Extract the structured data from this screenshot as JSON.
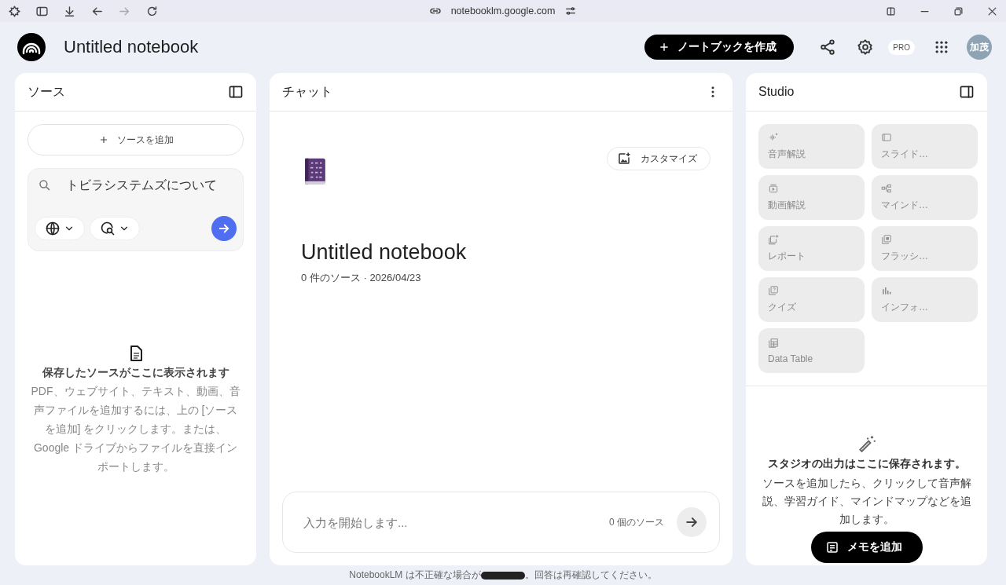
{
  "browser_bar": {
    "url": "notebooklm.google.com"
  },
  "header": {
    "title": "Untitled notebook",
    "create_button": "ノートブックを作成",
    "pro_badge": "PRO",
    "avatar": "加茂"
  },
  "sources": {
    "title": "ソース",
    "add_button": "ソースを追加",
    "search": {
      "value": "トビラシステムズについて"
    },
    "empty_title": "保存したソースがここに表示されます",
    "empty_text": "PDF、ウェブサイト、テキスト、動画、音声ファイルを追加するには、上の [ソースを追加] をクリックします。または、Google ドライブからファイルを直接インポートします。"
  },
  "chat": {
    "title": "チャット",
    "customize_button": "カスタマイズ",
    "notebook_title": "Untitled notebook",
    "meta": "0 件のソース · 2026/04/23",
    "input": {
      "placeholder": "入力を開始します..."
    },
    "source_count": "0 個のソース"
  },
  "studio": {
    "title": "Studio",
    "tools": [
      {
        "kind": "audio",
        "label": "音声解説",
        "disabled": true
      },
      {
        "kind": "slides",
        "label": "スライド…",
        "disabled": true
      },
      {
        "kind": "video",
        "label": "動画解説",
        "disabled": true
      },
      {
        "kind": "mindmap",
        "label": "マインド…",
        "disabled": true
      },
      {
        "kind": "report",
        "label": "レポート",
        "disabled": true
      },
      {
        "kind": "flashcards",
        "label": "フラッシ…",
        "disabled": true
      },
      {
        "kind": "quiz",
        "label": "クイズ",
        "disabled": true
      },
      {
        "kind": "infographic",
        "label": "インフォ…",
        "disabled": true
      },
      {
        "kind": "table",
        "label": "Data Table",
        "disabled": true
      }
    ],
    "empty_title": "スタジオの出力はここに保存されます。",
    "empty_text": "ソースを追加したら、クリックして音声解説、学習ガイド、マインドマップなどを追加します。",
    "note_button": "メモを追加"
  },
  "footer": {
    "before": "NotebookLM は不正確な場合が",
    "after": "。回答は再確認してください。"
  }
}
